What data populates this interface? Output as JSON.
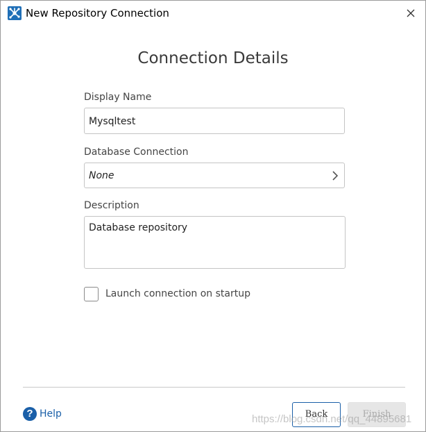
{
  "window": {
    "title": "New Repository Connection",
    "close_icon": "close-icon",
    "app_icon": "pentaho-spoon-icon"
  },
  "page": {
    "heading": "Connection Details"
  },
  "form": {
    "display_name": {
      "label": "Display Name",
      "value": "Mysqltest"
    },
    "database_connection": {
      "label": "Database Connection",
      "value": "None",
      "icon": "chevron-right-icon"
    },
    "description": {
      "label": "Description",
      "value": "Database repository"
    },
    "launch_on_startup": {
      "label": "Launch connection on startup",
      "checked": false
    }
  },
  "footer": {
    "help_label": "Help",
    "help_icon_glyph": "?",
    "back_label": "Back",
    "finish_label": "Finish",
    "finish_enabled": false
  },
  "watermark": "https://blog.csdn.net/qq_44895681",
  "colors": {
    "accent": "#1a5fa8",
    "border": "#c4c4c4",
    "disabled_bg": "#e6e6e6"
  }
}
